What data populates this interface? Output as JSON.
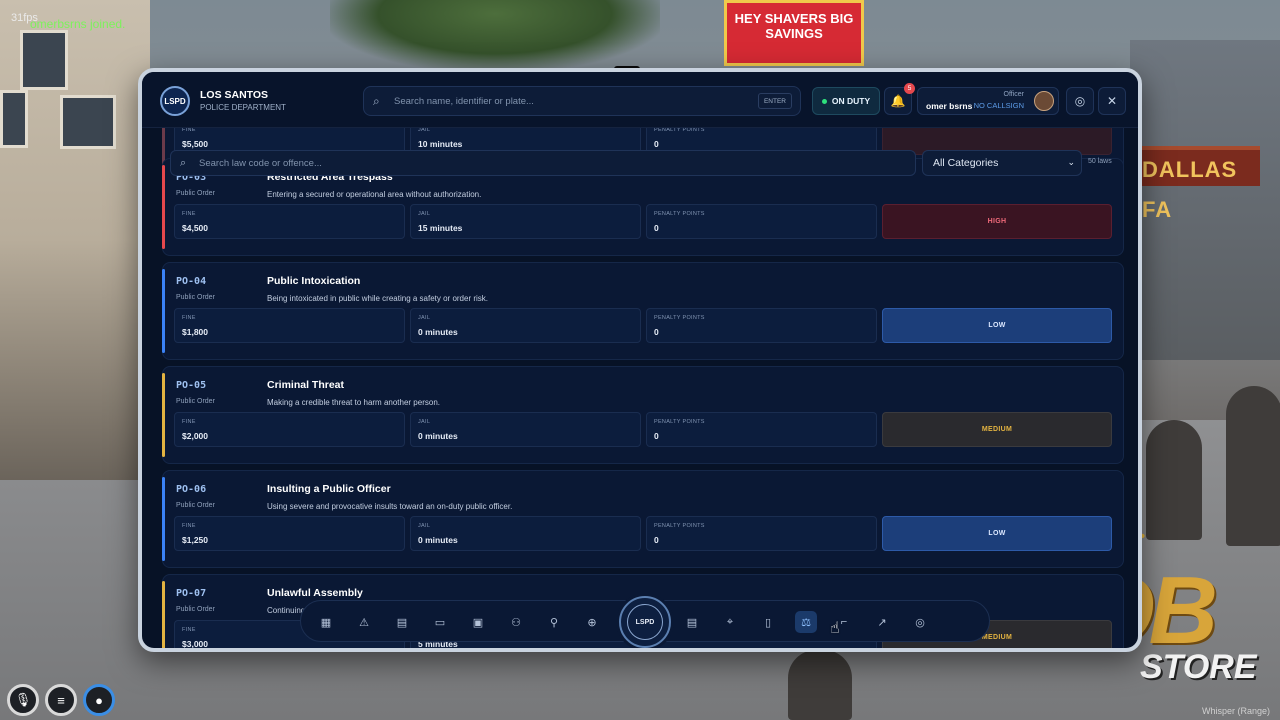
{
  "overlay": {
    "fps": "31fps",
    "join_message": "omerbsrns joined.",
    "whisper": "Whisper (Range)",
    "billboard": "HEY SHAVERS BIG SAVINGS",
    "storefront": "DALLAS FA",
    "logo_ob": "OB",
    "logo_store": "STORE"
  },
  "header": {
    "badge": "LSPD",
    "title": "LOS SANTOS",
    "subtitle": "POLICE DEPARTMENT",
    "search_placeholder": "Search name, identifier or plate...",
    "enter_hint": "ENTER",
    "duty_label": "ON DUTY",
    "notification_count": "5",
    "officer_role": "Officer",
    "officer_name": "omer bsrns",
    "officer_callsign": "NO CALLSIGN"
  },
  "filters": {
    "search_placeholder": "Search law code or offence...",
    "category": "All Categories",
    "count": "50 laws"
  },
  "laws": [
    {
      "code": "",
      "category": "",
      "title": "",
      "description": "",
      "fine": "$5,500",
      "jail": "10 minutes",
      "points": "0",
      "severity": "",
      "color": "#6b3a4a"
    },
    {
      "code": "PO-03",
      "category": "Public Order",
      "title": "Restricted Area Trespass",
      "description": "Entering a secured or operational area without authorization.",
      "fine": "$4,500",
      "jail": "15 minutes",
      "points": "0",
      "severity": "HIGH",
      "color": "#e5484d"
    },
    {
      "code": "PO-04",
      "category": "Public Order",
      "title": "Public Intoxication",
      "description": "Being intoxicated in public while creating a safety or order risk.",
      "fine": "$1,800",
      "jail": "0 minutes",
      "points": "0",
      "severity": "LOW",
      "color": "#3b82f6"
    },
    {
      "code": "PO-05",
      "category": "Public Order",
      "title": "Criminal Threat",
      "description": "Making a credible threat to harm another person.",
      "fine": "$2,000",
      "jail": "0 minutes",
      "points": "0",
      "severity": "MEDIUM",
      "color": "#e3b341"
    },
    {
      "code": "PO-06",
      "category": "Public Order",
      "title": "Insulting a Public Officer",
      "description": "Using severe and provocative insults toward an on-duty public officer.",
      "fine": "$1,250",
      "jail": "0 minutes",
      "points": "0",
      "severity": "LOW",
      "color": "#3b82f6"
    },
    {
      "code": "PO-07",
      "category": "Public Order",
      "title": "Unlawful Assembly",
      "description": "Continuing ...",
      "fine": "$3,000",
      "jail": "5 minutes",
      "points": "0",
      "severity": "MEDIUM",
      "color": "#e3b341"
    }
  ],
  "labels": {
    "fine": "FINE",
    "jail": "JAIL",
    "points": "PENALTY POINTS"
  },
  "dock": {
    "center_label": "LSPD",
    "icons": [
      "dashboard-icon",
      "warrant-icon",
      "report-icon",
      "camera-icon",
      "vehicle-icon",
      "people-icon",
      "profile-icon",
      "search-icon",
      "document-icon",
      "map-pin-icon",
      "file-icon",
      "law-scale-icon",
      "weapon-icon",
      "chart-icon",
      "settings-icon"
    ]
  }
}
